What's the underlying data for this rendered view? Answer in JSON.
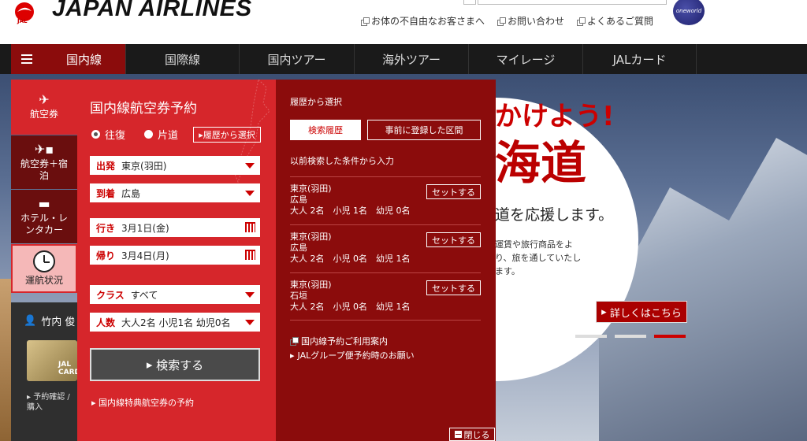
{
  "header": {
    "brand": "JAPAN AIRLINES",
    "logo_text": "JAL",
    "oneworld": "oneworld",
    "links": [
      "お体の不自由なお客さまへ",
      "お問い合わせ",
      "よくあるご質問"
    ]
  },
  "nav": {
    "items": [
      "国内線",
      "国際線",
      "国内ツアー",
      "海外ツアー",
      "マイレージ",
      "JALカード"
    ],
    "active": "国内線"
  },
  "side": {
    "tabs": [
      {
        "label": "航空券",
        "icon": "plane-icon"
      },
      {
        "label": "航空券＋宿泊",
        "icon": "plane-hotel-icon"
      },
      {
        "label": "ホテル・レンタカー",
        "icon": "hotel-car-icon"
      },
      {
        "label": "運航状況",
        "icon": "clock-icon"
      }
    ],
    "user_name": "竹内 俊",
    "card_text": "JAL CARD",
    "user_link": "予約確認 / 購入"
  },
  "booking": {
    "title": "国内線航空券予約",
    "round_trip": "往復",
    "one_way": "片道",
    "history_button": "履歴から選択",
    "departure_label": "出発",
    "departure_value": "東京(羽田)",
    "arrival_label": "到着",
    "arrival_value": "広島",
    "outbound_label": "行き",
    "outbound_value": "3月1日(金)",
    "return_label": "帰り",
    "return_value": "3月4日(月)",
    "class_label": "クラス",
    "class_value": "すべて",
    "pax_label": "人数",
    "pax_value": "大人2名 小児1名 幼児0名",
    "search_button": "検索する",
    "award_link": "国内線特典航空券の予約"
  },
  "history": {
    "title": "履歴から選択",
    "tab_recent": "検索履歴",
    "tab_registered": "事前に登録した区間",
    "note": "以前検索した条件から入力",
    "set_label": "セットする",
    "routes": [
      {
        "from": "東京(羽田)",
        "to": "広島",
        "pax": "大人 2名　小児 1名　幼児 0名"
      },
      {
        "from": "東京(羽田)",
        "to": "広島",
        "pax": "大人 2名　小児 0名　幼児 1名"
      },
      {
        "from": "東京(羽田)",
        "to": "石垣",
        "pax": "大人 2名　小児 0名　幼児 1名"
      }
    ],
    "link_guide": "国内線予約ご利用案内",
    "link_group": "JALグループ便予約時のお願い",
    "close": "閉じる"
  },
  "hero": {
    "line1": "かけよう!",
    "line2": "海道",
    "line3": "道を応援します。",
    "body": "運賃や旅行商品をより、旅を通していたします。",
    "button": "詳しくはこちら"
  },
  "colors": {
    "jal_red": "#d6262b",
    "dark_red": "#8b0c0c",
    "nav_bg": "#1a1a1a"
  }
}
